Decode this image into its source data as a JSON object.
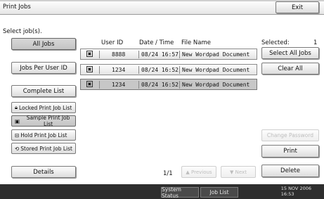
{
  "window": {
    "title": "Print Jobs",
    "exit_label": "Exit"
  },
  "prompt": "Select job(s).",
  "sidebar": {
    "all_jobs": "All Jobs",
    "jobs_per_user": "Jobs Per User ID",
    "complete_list": "Complete List",
    "locked": "Locked Print Job List",
    "sample": "Sample Print Job List",
    "hold": "Hold Print Job List",
    "stored": "Stored Print Job List",
    "details": "Details"
  },
  "table": {
    "headers": {
      "user_id": "User ID",
      "datetime": "Date / Time",
      "file_name": "File Name"
    },
    "rows": [
      {
        "user_id": "8888",
        "datetime": "08/24 16:57",
        "file_name": "New Wordpad Document"
      },
      {
        "user_id": "1234",
        "datetime": "08/24 16:52",
        "file_name": "New Wordpad Document"
      },
      {
        "user_id": "1234",
        "datetime": "08/24 16:52",
        "file_name": "New Wordpad Document"
      }
    ]
  },
  "right": {
    "selected_label": "Selected:",
    "selected_count": "1",
    "select_all": "Select All Jobs",
    "clear_all": "Clear All",
    "change_password": "Change Password",
    "print": "Print",
    "delete": "Delete"
  },
  "pager": {
    "page": "1/1",
    "previous": "▲ Previous",
    "next": "▼ Next"
  },
  "statusbar": {
    "system_status": "System Status",
    "job_list": "Job List",
    "date": "15 NOV  2006",
    "time": "16:53"
  },
  "colors": {
    "selected_row": "#c7c7c7",
    "statusbar": "#2e2e2e"
  }
}
